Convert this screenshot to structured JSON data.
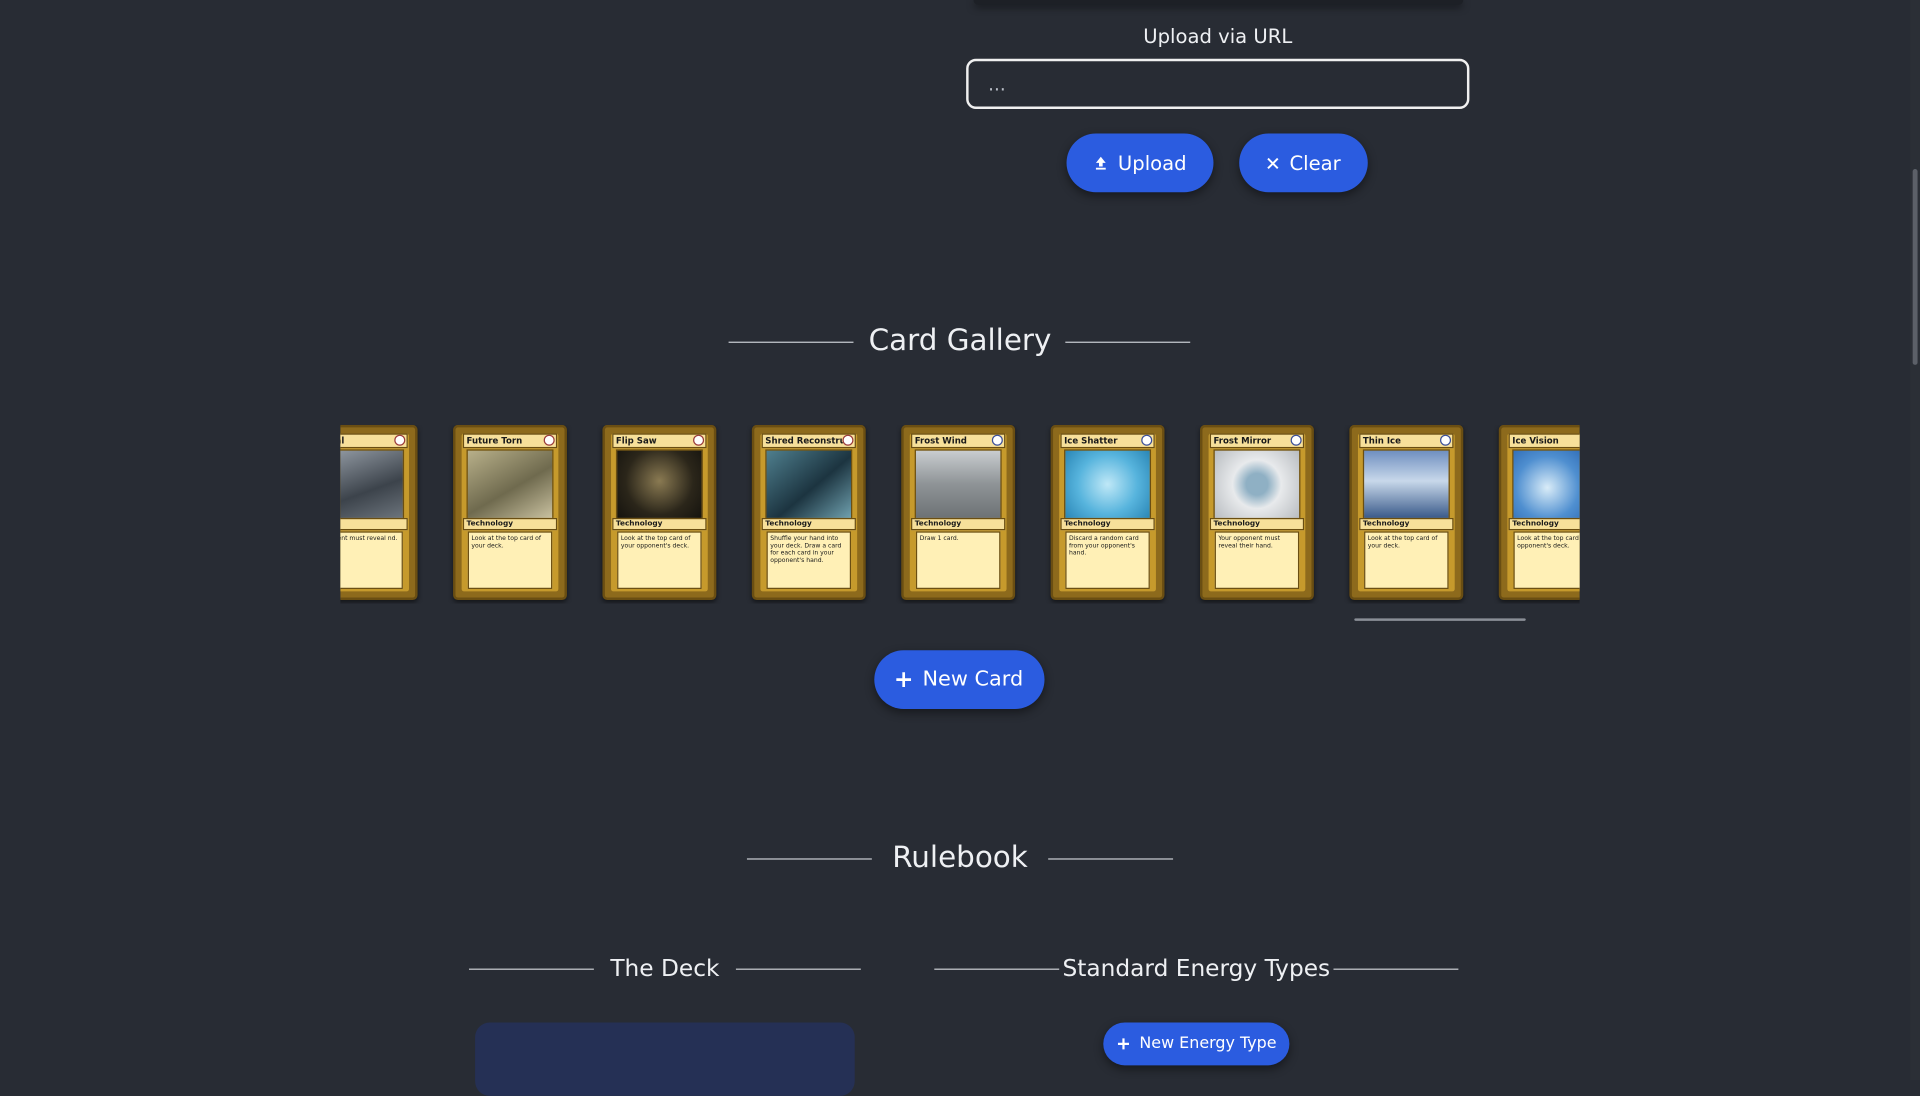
{
  "upload": {
    "label": "Upload via URL",
    "placeholder": "...",
    "upload_button": "Upload",
    "clear_button": "Clear"
  },
  "gallery": {
    "title": "Card Gallery",
    "cards": [
      {
        "name": "Metal",
        "type": "ology",
        "text": "pponent must reveal nd."
      },
      {
        "name": "Future Torn",
        "type": "Technology",
        "text": "Look at the top card of your deck."
      },
      {
        "name": "Flip Saw",
        "type": "Technology",
        "text": "Look at the top card of your opponent's deck."
      },
      {
        "name": "Shred Reconstru",
        "type": "Technology",
        "text": "Shuffle your hand into your deck. Draw a card for each card in your opponent's hand."
      },
      {
        "name": "Frost Wind",
        "type": "Technology",
        "text": "Draw 1 card."
      },
      {
        "name": "Ice Shatter",
        "type": "Technology",
        "text": "Discard a random card from your opponent's hand."
      },
      {
        "name": "Frost Mirror",
        "type": "Technology",
        "text": "Your opponent must reveal their hand."
      },
      {
        "name": "Thin Ice",
        "type": "Technology",
        "text": "Look at the top card of your deck."
      },
      {
        "name": "Ice Vision",
        "type": "Technology",
        "text": "Look at the top card o opponent's deck."
      }
    ],
    "new_card_button": "New Card"
  },
  "rulebook": {
    "title": "Rulebook",
    "deck_title": "The Deck",
    "energy_title": "Standard Energy Types",
    "new_energy_button": "New Energy Type"
  }
}
